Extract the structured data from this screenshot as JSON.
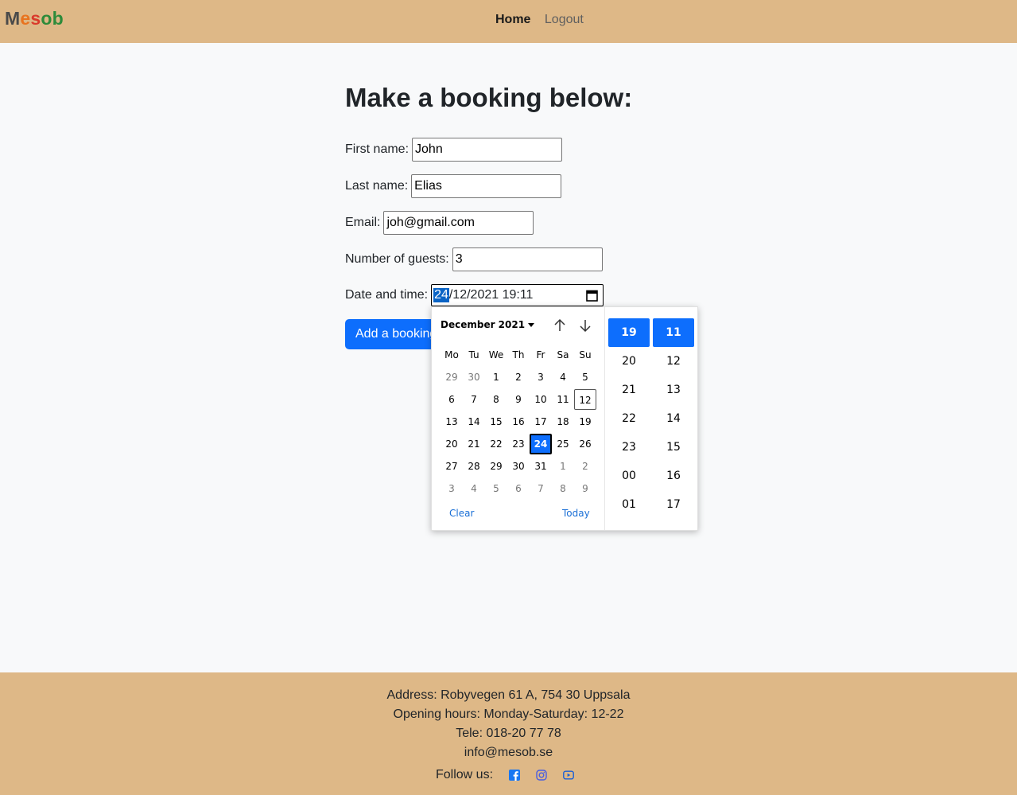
{
  "header": {
    "brand_letters": [
      "M",
      "e",
      "s",
      "ob"
    ],
    "nav": {
      "home": "Home",
      "logout": "Logout"
    }
  },
  "main": {
    "title": "Make a booking below:",
    "fields": {
      "first_name": {
        "label": "First name:",
        "value": "John"
      },
      "last_name": {
        "label": "Last name:",
        "value": "Elias"
      },
      "email": {
        "label": "Email:",
        "value": "joh@gmail.com"
      },
      "guests": {
        "label": "Number of guests:",
        "value": "3"
      },
      "datetime": {
        "label": "Date and time:",
        "day": "24",
        "rest": "/12/2021 19:11"
      }
    },
    "submit_label": "Add a booking"
  },
  "datepicker": {
    "month_label": "December 2021",
    "weekdays": [
      "Mo",
      "Tu",
      "We",
      "Th",
      "Fr",
      "Sa",
      "Su"
    ],
    "weeks": [
      [
        "29",
        "30",
        "1",
        "2",
        "3",
        "4",
        "5"
      ],
      [
        "6",
        "7",
        "8",
        "9",
        "10",
        "11",
        "12"
      ],
      [
        "13",
        "14",
        "15",
        "16",
        "17",
        "18",
        "19"
      ],
      [
        "20",
        "21",
        "22",
        "23",
        "24",
        "25",
        "26"
      ],
      [
        "27",
        "28",
        "29",
        "30",
        "31",
        "1",
        "2"
      ],
      [
        "3",
        "4",
        "5",
        "6",
        "7",
        "8",
        "9"
      ]
    ],
    "today_day": "12",
    "selected_day": "24",
    "clear_label": "Clear",
    "today_label": "Today",
    "hours": [
      "19",
      "20",
      "21",
      "22",
      "23",
      "00",
      "01"
    ],
    "minutes": [
      "11",
      "12",
      "13",
      "14",
      "15",
      "16",
      "17"
    ],
    "selected_hour": "19",
    "selected_minute": "11"
  },
  "footer": {
    "address": "Address: Robyvegen 61 A, 754 30 Uppsala",
    "hours": "Opening hours: Monday-Saturday: 12-22",
    "tele": "Tele: 018-20 77 78",
    "email": "info@mesob.se",
    "follow": "Follow us:",
    "social_icons": [
      "facebook-icon",
      "instagram-icon",
      "youtube-icon"
    ]
  },
  "colors": {
    "header_bg": "#deb887",
    "accent": "#0d6efd",
    "page_bg": "#f8f9fa"
  }
}
